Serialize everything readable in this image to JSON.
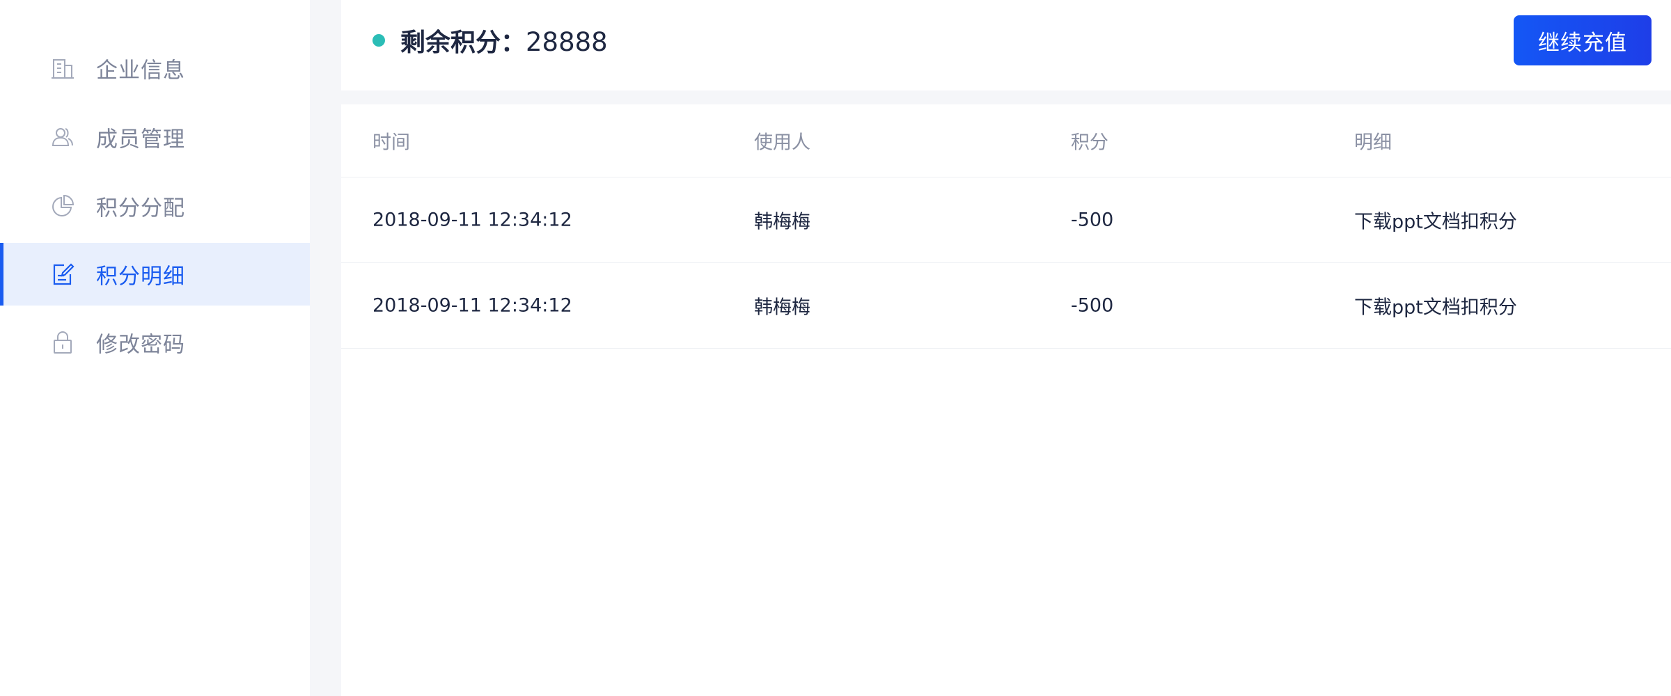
{
  "sidebar": {
    "items": [
      {
        "label": "企业信息",
        "icon": "building-icon",
        "active": false
      },
      {
        "label": "成员管理",
        "icon": "users-icon",
        "active": false
      },
      {
        "label": "积分分配",
        "icon": "pie-chart-icon",
        "active": false
      },
      {
        "label": "积分明细",
        "icon": "edit-document-icon",
        "active": true
      },
      {
        "label": "修改密码",
        "icon": "lock-icon",
        "active": false
      }
    ]
  },
  "header": {
    "balance_label": "剩余积分：",
    "balance_value": "28888",
    "recharge_button": "继续充值"
  },
  "table": {
    "columns": [
      "时间",
      "使用人",
      "积分",
      "明细"
    ],
    "rows": [
      [
        "2018-09-11 12:34:12",
        "韩梅梅",
        "-500",
        "下载ppt文档扣积分"
      ],
      [
        "2018-09-11 12:34:12",
        "韩梅梅",
        "-500",
        "下载ppt文档扣积分"
      ]
    ]
  },
  "colors": {
    "accent": "#1a5cf0",
    "active_bg": "#e8effd",
    "status_dot": "#2bbdb6"
  }
}
